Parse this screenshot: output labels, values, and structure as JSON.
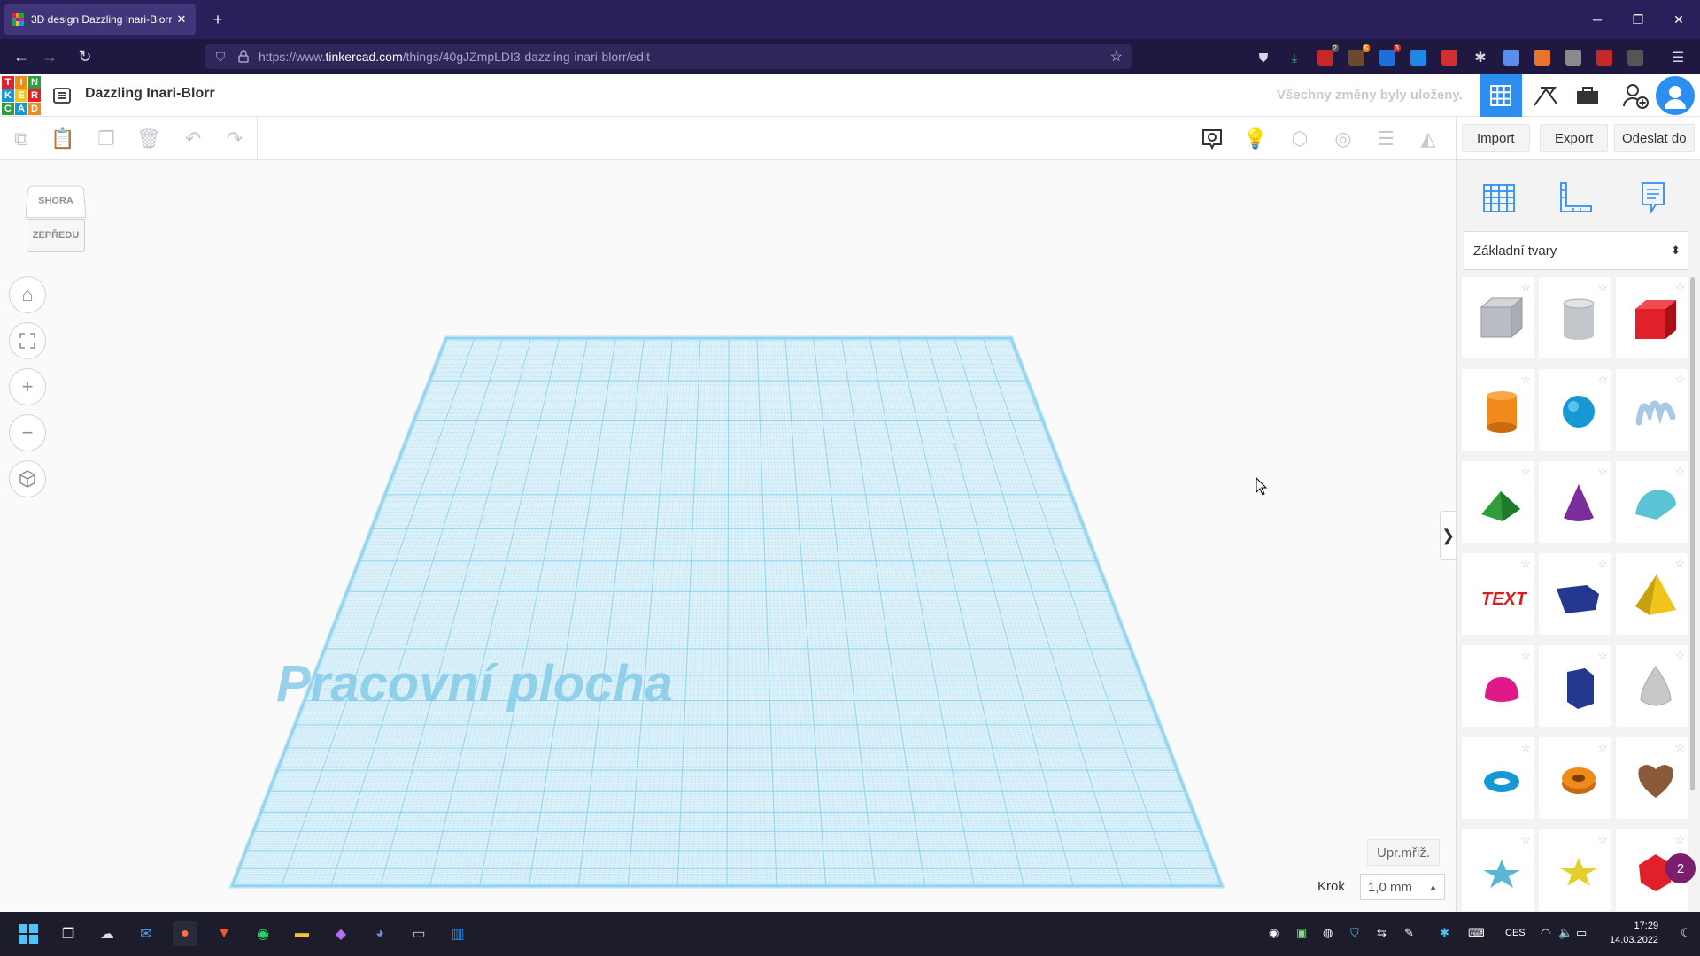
{
  "browser": {
    "tab_title": "3D design Dazzling Inari-Blorr |",
    "tab_close": "✕",
    "new_tab": "+",
    "url_prefix": "https://www.",
    "url_domain": "tinkercad.com",
    "url_path": "/things/40gJZmpLDI3-dazzling-inari-blorr/edit",
    "extension_badges": [
      "2",
      "5",
      "3"
    ]
  },
  "header": {
    "design_name": "Dazzling Inari-Blorr",
    "save_status": "Všechny změny byly uloženy."
  },
  "logo_letters": [
    "T",
    "I",
    "N",
    "K",
    "E",
    "R",
    "C",
    "A",
    "D"
  ],
  "toolbar": {
    "import_label": "Import",
    "export_label": "Export",
    "send_label": "Odeslat do"
  },
  "viewcube": {
    "top_label": "SHORA",
    "front_label": "ZEPŘEDU"
  },
  "workplane": {
    "label": "Pracovní plocha",
    "grid_button": "Upr.mřiž.",
    "snap_label": "Krok",
    "snap_value": "1,0 mm"
  },
  "panel": {
    "library_selected": "Základní tvary",
    "notification_count": "2"
  },
  "shapes": [
    {
      "name": "box-hole",
      "color": "#b9bcc2"
    },
    {
      "name": "cylinder-hole",
      "color": "#c3c6cb"
    },
    {
      "name": "box",
      "color": "#e0202a"
    },
    {
      "name": "cylinder",
      "color": "#f08a1a"
    },
    {
      "name": "sphere",
      "color": "#1598d4"
    },
    {
      "name": "scribble",
      "color": "#a9c7e6"
    },
    {
      "name": "roof",
      "color": "#2f9e3a"
    },
    {
      "name": "cone",
      "color": "#7b2d9c"
    },
    {
      "name": "round-roof",
      "color": "#5bc3d6"
    },
    {
      "name": "text",
      "color": "#d21f1f"
    },
    {
      "name": "wedge",
      "color": "#24388f"
    },
    {
      "name": "pyramid",
      "color": "#f0c419"
    },
    {
      "name": "half-sphere",
      "color": "#e0198a"
    },
    {
      "name": "polygon",
      "color": "#24388f"
    },
    {
      "name": "paraboloid",
      "color": "#c8c8c8"
    },
    {
      "name": "torus",
      "color": "#1598d4"
    },
    {
      "name": "tube",
      "color": "#f08a1a"
    },
    {
      "name": "heart",
      "color": "#8a5a3a"
    },
    {
      "name": "star",
      "color": "#5bb6d6"
    },
    {
      "name": "star-yellow",
      "color": "#e4cf2c"
    },
    {
      "name": "icosahedron",
      "color": "#e0202a"
    }
  ],
  "taskbar": {
    "language": "CES",
    "time": "17:29",
    "date": "14.03.2022"
  },
  "colors": {
    "accent": "#2d8ef2",
    "browser_bg": "#2b1f5b",
    "grid_line": "#8fd3ee",
    "grid_fill": "#dff2fa"
  }
}
